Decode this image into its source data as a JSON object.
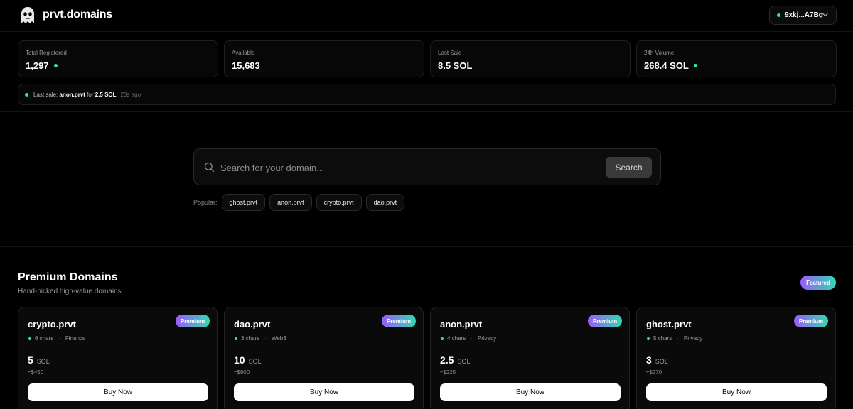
{
  "app": {
    "brand": "prvt.domains"
  },
  "wallet": {
    "address": "9xkj...A7Bg"
  },
  "stats": [
    {
      "label": "Total Registered",
      "value": "1,297",
      "live": true
    },
    {
      "label": "Available",
      "value": "15,683",
      "live": false
    },
    {
      "label": "Last Sale",
      "value": "8.5 SOL",
      "live": false
    },
    {
      "label": "24h Volume",
      "value": "268.4 SOL",
      "live": true
    }
  ],
  "ticker": {
    "prefix": "Last sale:",
    "domain": "anon.prvt",
    "mid": "for",
    "amount": "2.5 SOL",
    "ago": "23s ago"
  },
  "search": {
    "placeholder": "Search for your domain...",
    "button": "Search"
  },
  "popular": {
    "label": "Popular:",
    "items": [
      "ghost.prvt",
      "anon.prvt",
      "crypto.prvt",
      "dao.prvt"
    ]
  },
  "premium": {
    "title": "Premium Domains",
    "subtitle": "Hand-picked high-value domains",
    "featured_badge": "Featured",
    "cards": [
      {
        "name": "crypto.prvt",
        "badge": "Premium",
        "chars": "6 chars",
        "category": "Finance",
        "price": "5",
        "currency": "SOL",
        "usd": "≈$450",
        "buy": "Buy Now"
      },
      {
        "name": "dao.prvt",
        "badge": "Premium",
        "chars": "3 chars",
        "category": "Web3",
        "price": "10",
        "currency": "SOL",
        "usd": "≈$900",
        "buy": "Buy Now"
      },
      {
        "name": "anon.prvt",
        "badge": "Premium",
        "chars": "4 chars",
        "category": "Privacy",
        "price": "2.5",
        "currency": "SOL",
        "usd": "≈$225",
        "buy": "Buy Now"
      },
      {
        "name": "ghost.prvt",
        "badge": "Premium",
        "chars": "5 chars",
        "category": "Privacy",
        "price": "3",
        "currency": "SOL",
        "usd": "≈$270",
        "buy": "Buy Now"
      }
    ]
  },
  "colors": {
    "accent_green": "#2ee6a3",
    "gradient_start": "#9b5cf6",
    "gradient_end": "#2fd9b5",
    "background": "#000000"
  },
  "icons": {
    "logo": "ghost-logo-icon",
    "search": "search-icon",
    "chevron": "chevron-down-icon"
  }
}
